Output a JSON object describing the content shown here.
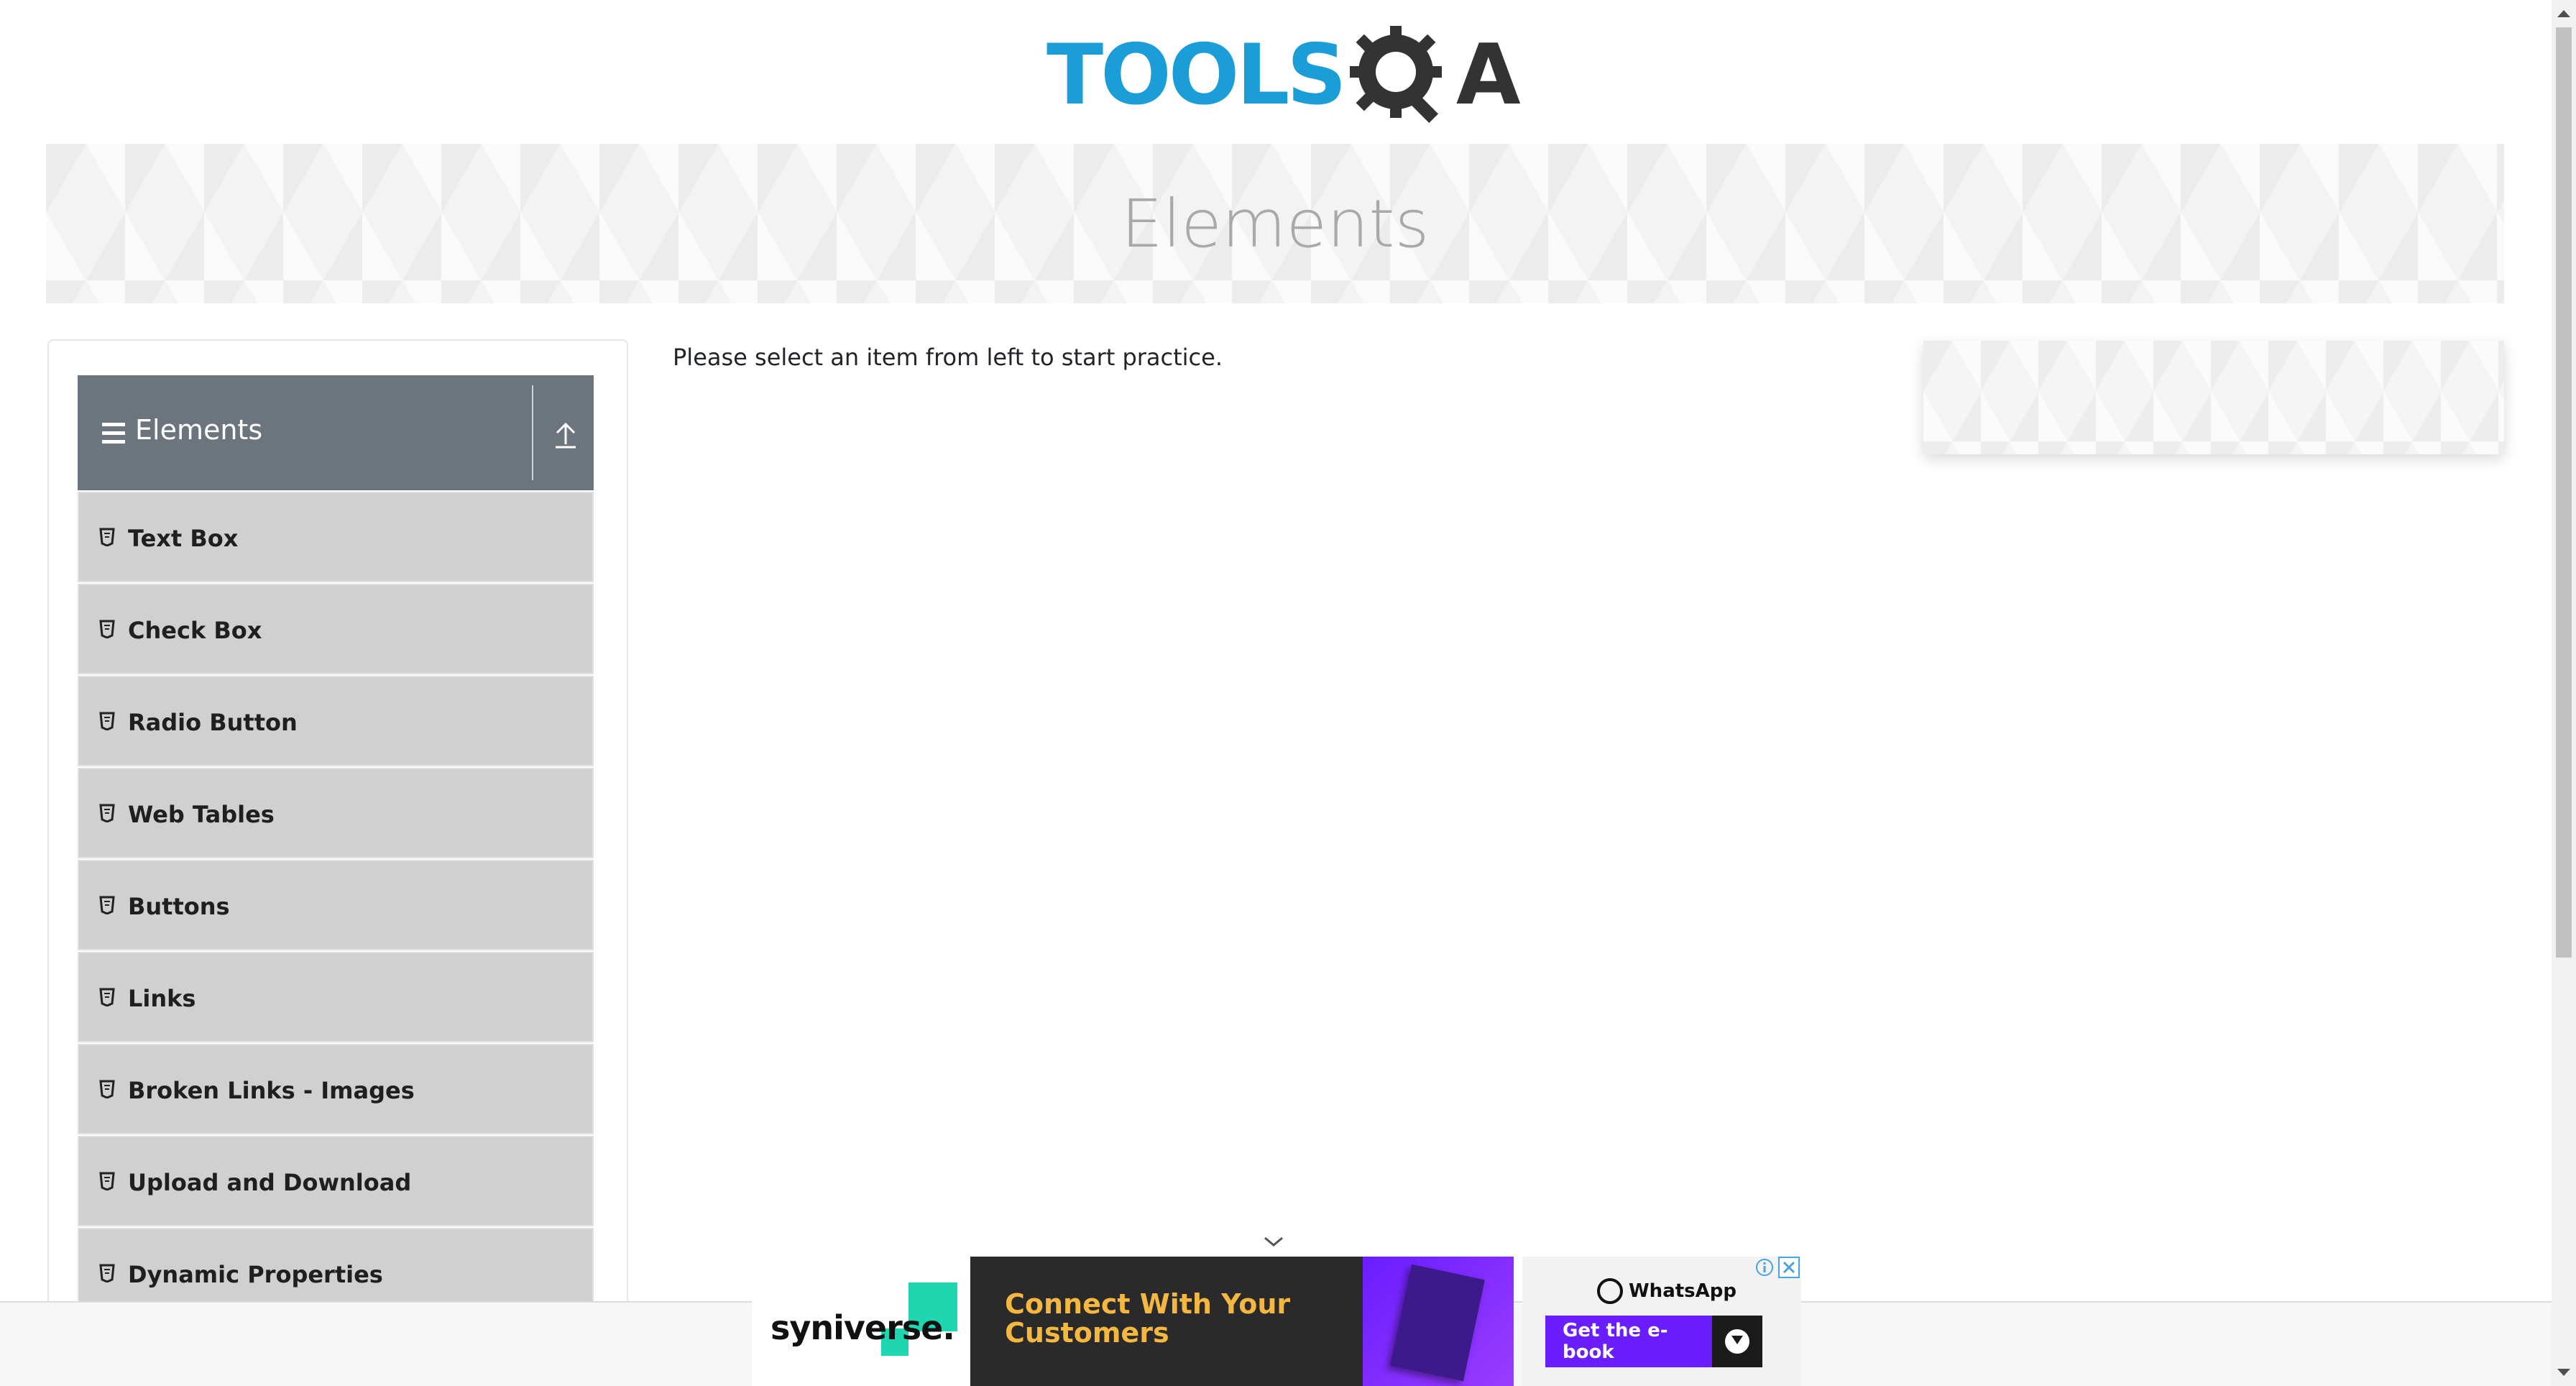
{
  "header": {
    "logo_text_tools": "TOOLS",
    "logo_text_a": "A",
    "logo_alt": "TOOLSQA"
  },
  "banner": {
    "title": "Elements"
  },
  "sidebar": {
    "group_title": "Elements",
    "items": [
      {
        "label": "Text Box"
      },
      {
        "label": "Check Box"
      },
      {
        "label": "Radio Button"
      },
      {
        "label": "Web Tables"
      },
      {
        "label": "Buttons"
      },
      {
        "label": "Links"
      },
      {
        "label": "Broken Links - Images"
      },
      {
        "label": "Upload and Download"
      },
      {
        "label": "Dynamic Properties"
      }
    ]
  },
  "main": {
    "instruction": "Please select an item from left to start practice."
  },
  "ad": {
    "brand": "syniverse.",
    "headline": "Connect With Your Customers",
    "whatsapp_label": "WhatsApp",
    "cta_label": "Get the e-book"
  },
  "colors": {
    "logo_blue": "#1b9dd7",
    "group_header_bg": "#6c757d",
    "menu_item_bg": "#d0d0d0",
    "ad_headline": "#f4b73f",
    "ad_purple": "#6a1dff",
    "ad_accent": "#1ed6b0"
  }
}
